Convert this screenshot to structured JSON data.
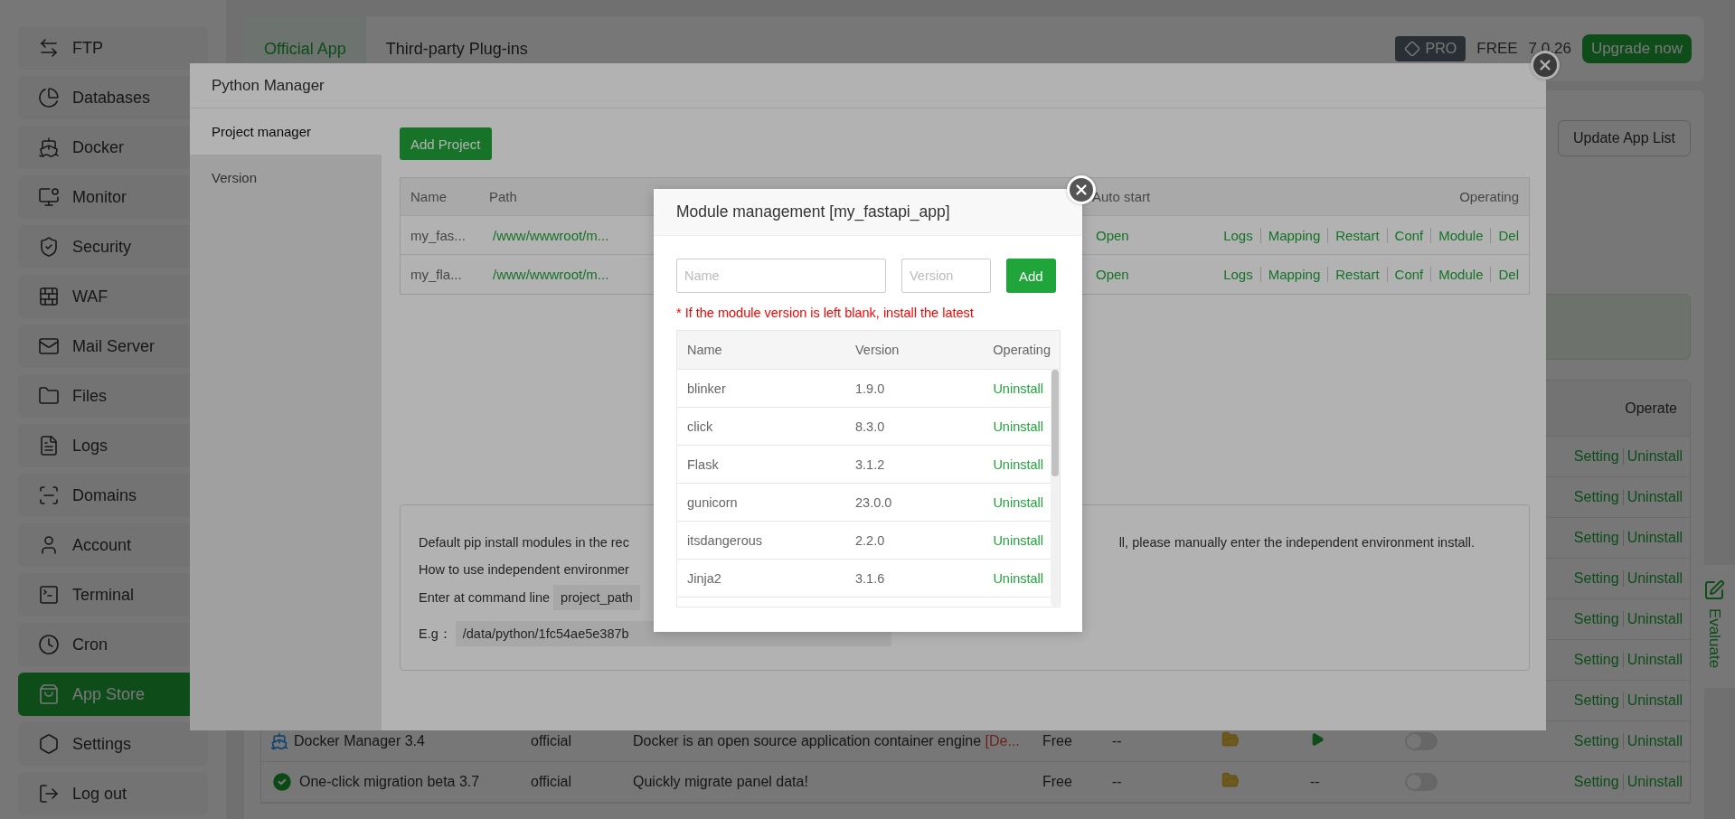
{
  "sidebar": {
    "items": [
      {
        "label": "FTP",
        "selected": false
      },
      {
        "label": "Databases",
        "selected": false
      },
      {
        "label": "Docker",
        "selected": false
      },
      {
        "label": "Monitor",
        "selected": false
      },
      {
        "label": "Security",
        "selected": false
      },
      {
        "label": "WAF",
        "selected": false
      },
      {
        "label": "Mail Server",
        "selected": false
      },
      {
        "label": "Files",
        "selected": false
      },
      {
        "label": "Logs",
        "selected": false
      },
      {
        "label": "Domains",
        "selected": false
      },
      {
        "label": "Account",
        "selected": false
      },
      {
        "label": "Terminal",
        "selected": false
      },
      {
        "label": "Cron",
        "selected": false
      },
      {
        "label": "App Store",
        "selected": true
      },
      {
        "label": "Settings",
        "selected": false
      },
      {
        "label": "Log out",
        "selected": false
      }
    ]
  },
  "top_bar": {
    "tabs": [
      {
        "label": "Official App",
        "selected": true
      },
      {
        "label": "Third-party Plug-ins",
        "selected": false
      }
    ],
    "pro_badge": "PRO",
    "edition": "FREE",
    "version": "7.0.26",
    "upgrade_button": "Upgrade now"
  },
  "app_store": {
    "update_button": "Update App List",
    "operate_header": "Operate",
    "rows": [
      {
        "kind": "covered",
        "actions": [
          "Setting",
          "Uninstall"
        ]
      },
      {
        "kind": "covered",
        "actions": [
          "Setting",
          "Uninstall"
        ]
      },
      {
        "kind": "covered",
        "actions": [
          "Setting",
          "Uninstall"
        ]
      },
      {
        "kind": "covered",
        "actions": [
          "Setting",
          "Uninstall"
        ]
      },
      {
        "kind": "covered",
        "actions": [
          "Setting",
          "Uninstall"
        ]
      },
      {
        "kind": "covered",
        "actions": [
          "Setting",
          "Uninstall"
        ]
      },
      {
        "kind": "covered",
        "actions": [
          "Setting",
          "Uninstall"
        ]
      },
      {
        "kind": "app",
        "name": "Docker Manager 3.4",
        "type": "official",
        "description": "Docker is an open source application container engine ",
        "description_tag": "[De...",
        "price": "Free",
        "expire": "--",
        "running": true,
        "on": false,
        "actions": [
          "Setting",
          "Uninstall"
        ]
      },
      {
        "kind": "app",
        "name": "One-click migration beta 3.7",
        "type": "official",
        "description": "Quickly migrate panel data!",
        "price": "Free",
        "expire": "--",
        "running": false,
        "status": "--",
        "on": false,
        "actions": [
          "Setting",
          "Uninstall"
        ]
      }
    ]
  },
  "evaluate_tab": "Evaluate",
  "python_manager": {
    "title": "Python Manager",
    "nav": [
      {
        "label": "Project manager",
        "selected": true
      },
      {
        "label": "Version",
        "selected": false
      }
    ],
    "add_button": "Add Project",
    "projects": {
      "columns": [
        "Name",
        "Path",
        "Auto start",
        "Operating"
      ],
      "rows": [
        {
          "name": "my_fas...",
          "path": "/www/wwwroot/m...",
          "auto_start": "Open",
          "actions": [
            "Logs",
            "Mapping",
            "Restart",
            "Conf",
            "Module",
            "Del"
          ]
        },
        {
          "name": "my_fla...",
          "path": "/www/wwwroot/m...",
          "auto_start": "Open",
          "actions": [
            "Logs",
            "Mapping",
            "Restart",
            "Conf",
            "Module",
            "Del"
          ]
        }
      ]
    },
    "info": {
      "line_1_start": "Default pip install modules in the rec",
      "line_1_end": "ll, please manually enter the independent environment install.",
      "line_2": "How to use independent environmer",
      "line_3": "Enter at command line",
      "line_3_code": "project_path",
      "line_4": "E.g：",
      "line_4_code": "/data/python/1fc54ae5e387b"
    }
  },
  "module_dialog": {
    "title": "Module management [my_fastapi_app]",
    "name_placeholder": "Name",
    "version_placeholder": "Version",
    "add_button": "Add",
    "warning": "* If the module version is left blank, install the latest",
    "columns": [
      "Name",
      "Version",
      "Operating"
    ],
    "rows": [
      {
        "name": "blinker",
        "version": "1.9.0",
        "action": "Uninstall"
      },
      {
        "name": "click",
        "version": "8.3.0",
        "action": "Uninstall"
      },
      {
        "name": "Flask",
        "version": "3.1.2",
        "action": "Uninstall"
      },
      {
        "name": "gunicorn",
        "version": "23.0.0",
        "action": "Uninstall"
      },
      {
        "name": "itsdangerous",
        "version": "2.2.0",
        "action": "Uninstall"
      },
      {
        "name": "Jinja2",
        "version": "3.1.6",
        "action": "Uninstall"
      }
    ]
  }
}
